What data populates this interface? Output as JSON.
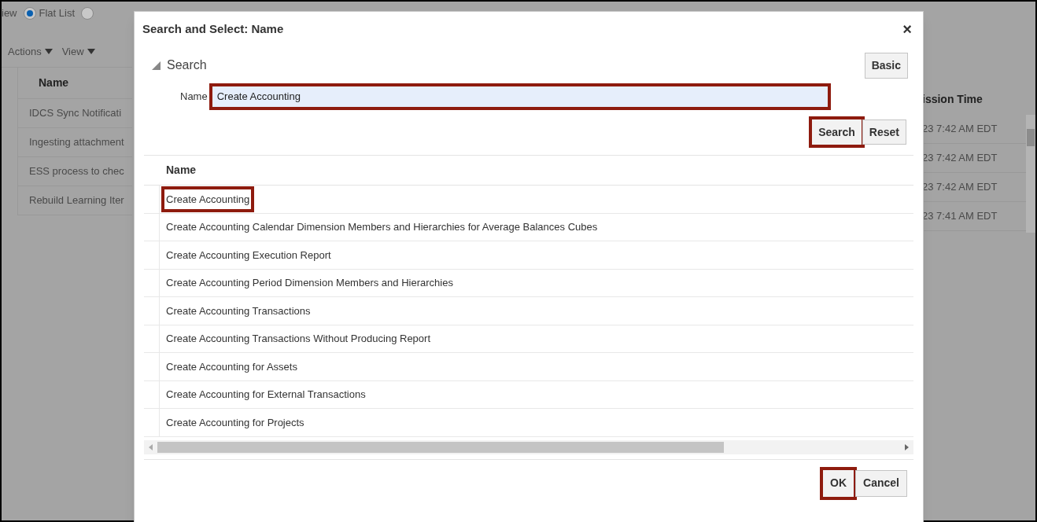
{
  "background": {
    "view_label": "iew",
    "radios": [
      {
        "label": "Flat List",
        "selected": true
      },
      {
        "selected": false
      }
    ],
    "menus": [
      "Actions",
      "View"
    ],
    "columns": [
      "Name",
      "ission Time"
    ],
    "rows": [
      {
        "name": "IDCS Sync Notificati",
        "time": "23 7:42 AM EDT"
      },
      {
        "name": "Ingesting attachment",
        "time": "23 7:42 AM EDT"
      },
      {
        "name": "ESS process to chec",
        "time": "23 7:42 AM EDT"
      },
      {
        "name": "Rebuild Learning Iter",
        "time": "23 7:41 AM EDT"
      }
    ]
  },
  "dialog": {
    "title": "Search and Select: Name",
    "close": "×",
    "search_section": {
      "label": "Search",
      "expanded": true
    },
    "mode_button": "Basic",
    "field": {
      "label": "Name",
      "value": "Create Accounting",
      "highlighted": true
    },
    "search_buttons": [
      {
        "label": "Search",
        "highlighted": true
      },
      {
        "label": "Reset",
        "highlighted": false
      }
    ],
    "results": {
      "column": "Name",
      "rows": [
        {
          "name": "Create Accounting",
          "highlighted": true
        },
        {
          "name": "Create Accounting Calendar Dimension Members and Hierarchies for Average Balances Cubes",
          "highlighted": false
        },
        {
          "name": "Create Accounting Execution Report",
          "highlighted": false
        },
        {
          "name": "Create Accounting Period Dimension Members and Hierarchies",
          "highlighted": false
        },
        {
          "name": "Create Accounting Transactions",
          "highlighted": false
        },
        {
          "name": "Create Accounting Transactions Without Producing Report",
          "highlighted": false
        },
        {
          "name": "Create Accounting for Assets",
          "highlighted": false
        },
        {
          "name": "Create Accounting for External Transactions",
          "highlighted": false
        },
        {
          "name": "Create Accounting for Projects",
          "highlighted": false
        }
      ]
    },
    "footer_buttons": [
      {
        "label": "OK",
        "highlighted": true
      },
      {
        "label": "Cancel",
        "highlighted": false
      }
    ]
  }
}
